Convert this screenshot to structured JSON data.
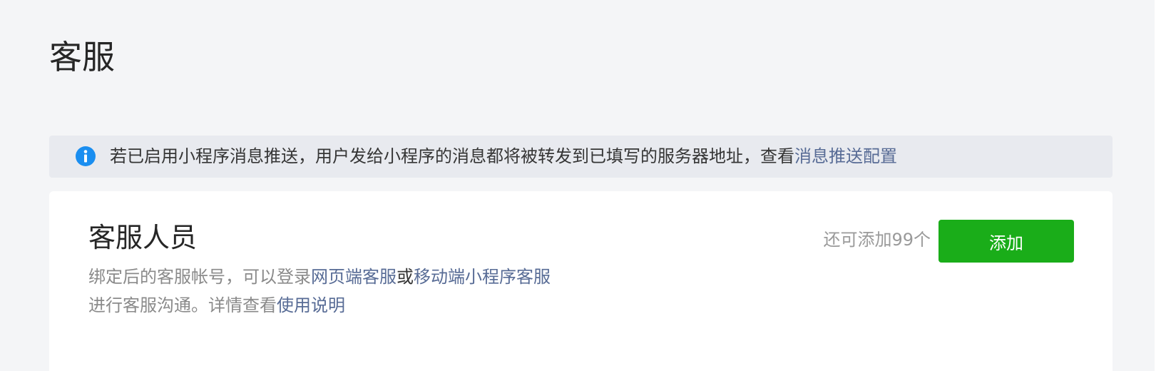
{
  "page": {
    "title": "客服"
  },
  "notice": {
    "icon": "info-icon",
    "icon_color": "#1a8ef0",
    "text": "若已启用小程序消息推送，用户发给小程序的消息都将被转发到已填写的服务器地址，查看",
    "link_label": "消息推送配置"
  },
  "staff": {
    "title": "客服人员",
    "desc_line1_prefix": "绑定后的客服帐号，可以登录",
    "web_link": "网页端客服",
    "or_text": "或",
    "mobile_link": "移动端小程序客服",
    "desc_line2_prefix": "进行客服沟通。详情查看",
    "help_link": "使用说明",
    "quota_text": "还可添加99个",
    "add_button": "添加",
    "button_color": "#1aad19"
  },
  "colors": {
    "link": "#576b95",
    "background": "#f4f5f7"
  }
}
